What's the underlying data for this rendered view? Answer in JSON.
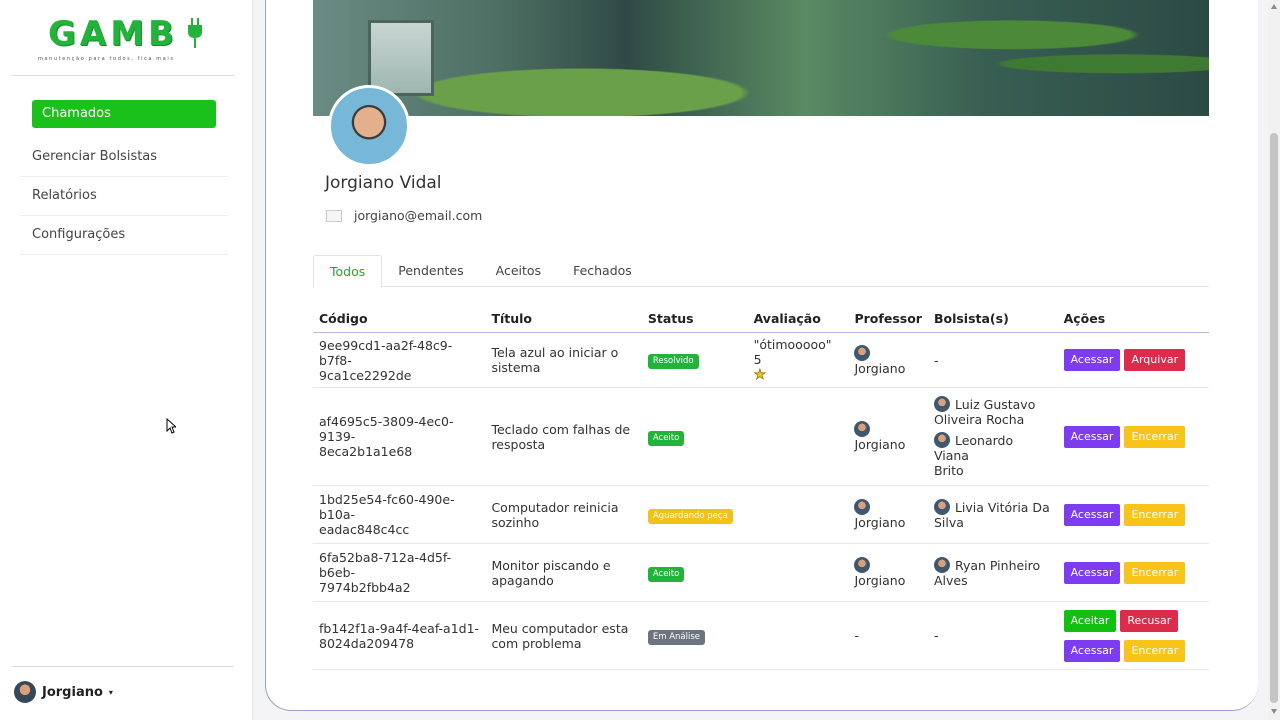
{
  "brand": {
    "logo": "GAMB",
    "tagline": "manutenção para todos, fica mais"
  },
  "sidebar": {
    "items": [
      {
        "label": "Chamados",
        "active": true
      },
      {
        "label": "Gerenciar Bolsistas"
      },
      {
        "label": "Relatórios"
      },
      {
        "label": "Configurações"
      }
    ],
    "user": {
      "name": "Jorgiano",
      "caret": "▾"
    }
  },
  "profile": {
    "name": "Jorgiano Vidal",
    "email": "jorgiano@email.com"
  },
  "tabs": [
    {
      "label": "Todos",
      "active": true
    },
    {
      "label": "Pendentes"
    },
    {
      "label": "Aceitos"
    },
    {
      "label": "Fechados"
    }
  ],
  "table": {
    "headers": [
      "Código",
      "Título",
      "Status",
      "Avaliação",
      "Professor",
      "Bolsista(s)",
      "Ações"
    ],
    "rows": [
      {
        "code_a": "9ee99cd1-aa2f-48c9-b7f8-",
        "code_b": "9ca1ce2292de",
        "title_a": "Tela azul ao iniciar o",
        "title_b": "sistema",
        "status": "Resolvido",
        "rating_text": "\"ótimooooo\" 5",
        "rating_star": "★",
        "professor": "Jorgiano",
        "bolsistas_none": "-",
        "actions": [
          "Acessar",
          "Arquivar"
        ]
      },
      {
        "code_a": "af4695c5-3809-4ec0-9139-",
        "code_b": "8eca2b1a1e68",
        "title_a": "Teclado com falhas de",
        "title_b": "resposta",
        "status": "Aceito",
        "professor": "Jorgiano",
        "bolsista1_a": "Luiz Gustavo",
        "bolsista1_b": "Oliveira Rocha",
        "bolsista2_a": "Leonardo Viana",
        "bolsista2_b": "Brito",
        "actions": [
          "Acessar",
          "Encerrar"
        ]
      },
      {
        "code_a": "1bd25e54-fc60-490e-b10a-",
        "code_b": "eadac848c4cc",
        "title_a": "Computador reinicia",
        "title_b": "sozinho",
        "status": "Aguardando peça",
        "professor": "Jorgiano",
        "bolsista1_a": "Livia Vitória Da",
        "bolsista1_b": "Silva",
        "actions": [
          "Acessar",
          "Encerrar"
        ]
      },
      {
        "code_a": "6fa52ba8-712a-4d5f-b6eb-",
        "code_b": "7974b2fbb4a2",
        "title_a": "Monitor piscando e",
        "title_b": "apagando",
        "status": "Aceito",
        "professor": "Jorgiano",
        "bolsista1_a": "Ryan Pinheiro",
        "bolsista1_b": "Alves",
        "actions": [
          "Acessar",
          "Encerrar"
        ]
      },
      {
        "code_a": "fb142f1a-9a4f-4eaf-a1d1-",
        "code_b": "8024da209478",
        "title_a": "Meu computador esta",
        "title_b": "com problema",
        "status": "Em Análise",
        "professor_none": "-",
        "bolsistas_none": "-",
        "actions": [
          "Aceitar",
          "Recusar",
          "Acessar",
          "Encerrar"
        ]
      }
    ]
  },
  "colors": {
    "accent": "#1bc11b",
    "purple": "#7d3cf0",
    "red": "#dc2b4b",
    "yellow": "#f8c41a"
  }
}
